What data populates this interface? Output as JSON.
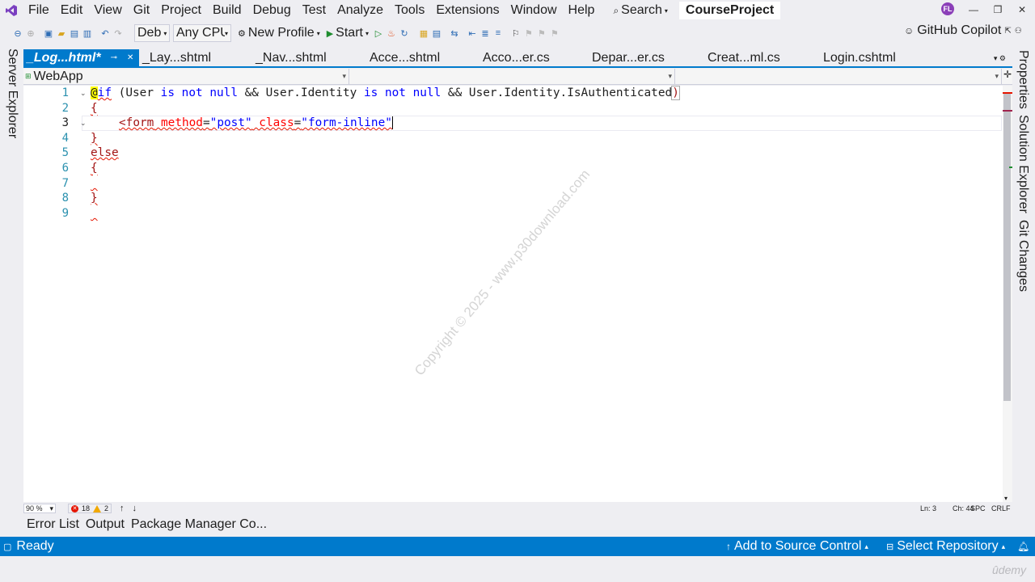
{
  "menubar": {
    "items": [
      "File",
      "Edit",
      "View",
      "Git",
      "Project",
      "Build",
      "Debug",
      "Test",
      "Analyze",
      "Tools",
      "Extensions",
      "Window",
      "Help"
    ],
    "search_label": "Search",
    "project_title": "CourseProject",
    "account_initials": "FL"
  },
  "toolbar": {
    "config": "Deb",
    "platform": "Any CPU",
    "profile": "New Profile",
    "start": "Start",
    "copilot": "GitHub Copilot"
  },
  "left_strip": {
    "server_explorer": "Server Explorer"
  },
  "right_strip": {
    "properties": "Properties",
    "solution_explorer": "Solution Explorer",
    "git_changes": "Git Changes"
  },
  "tabs": [
    {
      "label": "_Log...html*",
      "active": true
    },
    {
      "label": "_Lay...shtml",
      "active": false
    },
    {
      "label": "_Nav...shtml",
      "active": false
    },
    {
      "label": "Acce...shtml",
      "active": false
    },
    {
      "label": "Acco...er.cs",
      "active": false
    },
    {
      "label": "Depar...er.cs",
      "active": false
    },
    {
      "label": "Creat...ml.cs",
      "active": false
    },
    {
      "label": "Login.cshtml",
      "active": false
    }
  ],
  "navbar": {
    "project": "WebApp",
    "member1": "",
    "member2": ""
  },
  "editor": {
    "line_numbers": [
      "1",
      "2",
      "3",
      "4",
      "5",
      "6",
      "7",
      "8",
      "9"
    ],
    "current_line": 3,
    "code": {
      "l1_at": "@",
      "l1_if": "if",
      "l1_open": " (",
      "l1_user": "User ",
      "l1_is": "is",
      "l1_sp1": " ",
      "l1_not": "not",
      "l1_sp2": " ",
      "l1_null": "null",
      "l1_and": " && User.Identity ",
      "l1_is2": "is",
      "l1_sp3": " ",
      "l1_not2": "not",
      "l1_sp4": " ",
      "l1_null2": "null",
      "l1_tail": " && User.Identity.IsAuthenticated",
      "l1_close": ")",
      "l2": "{",
      "l3_tag": "<form",
      "l3_attr1": " method",
      "l3_eq1": "=",
      "l3_val1": "\"post\"",
      "l3_attr2": " class",
      "l3_eq2": "=",
      "l3_val2": "\"form-inline\"",
      "l4": "}",
      "l5": "else",
      "l6": "{",
      "l7": "",
      "l8": "}",
      "l9": ""
    },
    "watermark": "Copyright © 2025 - www.p30download.com"
  },
  "editor_status": {
    "zoom": "90 %",
    "errors": "18",
    "warnings": "2",
    "line": "Ln: 3",
    "col": "Ch: 44",
    "spc": "SPC",
    "eol": "CRLF"
  },
  "bottom_tabs": [
    "Error List",
    "Output",
    "Package Manager Co..."
  ],
  "statusbar": {
    "ready": "Ready",
    "source_control": "Add to Source Control",
    "repository": "Select Repository"
  },
  "branding": {
    "udemy": "ûdemy"
  },
  "colors": {
    "accent": "#007acc",
    "keyword": "#0000ff",
    "tag": "#a31515",
    "attribute": "#ff0000"
  }
}
